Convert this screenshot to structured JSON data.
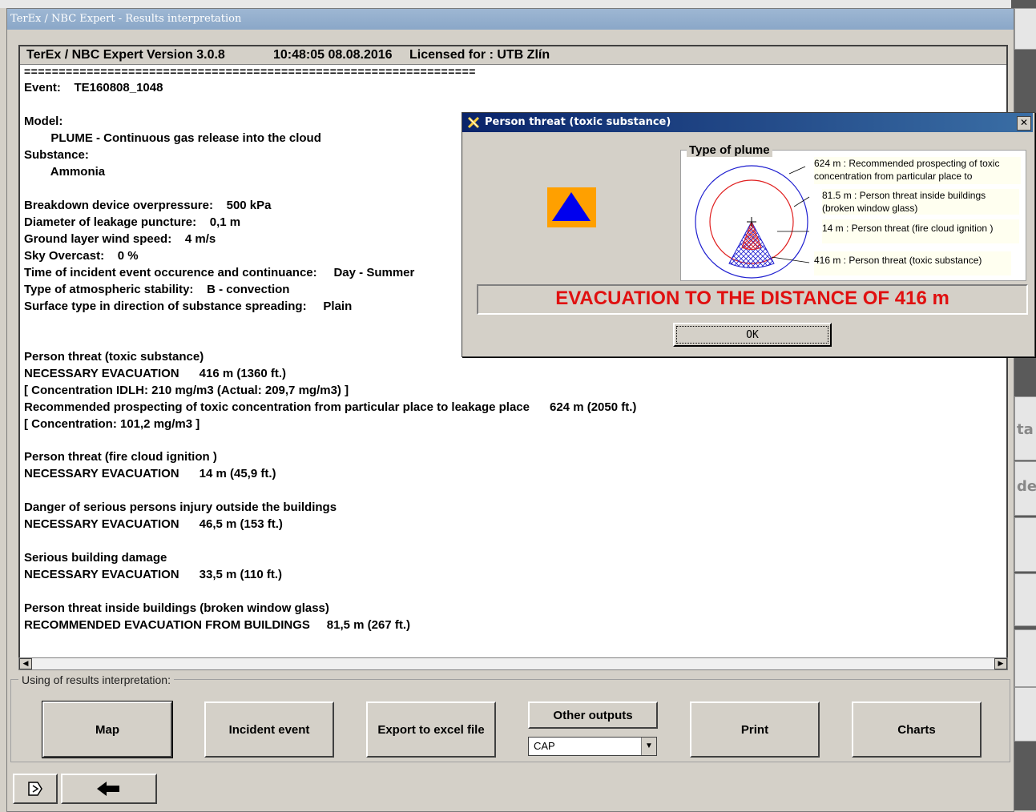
{
  "window": {
    "title": "TerEx / NBC Expert - Results interpretation"
  },
  "report": {
    "header": {
      "app": "TerEx / NBC Expert  Version 3.0.8",
      "datetime": "10:48:05  08.08.2016",
      "license": "Licensed for : UTB Zlín"
    },
    "separator": "=================================================================",
    "lines": [
      "Event:    TE160808_1048",
      "Model:",
      "        PLUME - Continuous gas release into the cloud",
      "Substance:",
      "        Ammonia",
      "Breakdown device overpressure:    500 kPa",
      "Diameter of leakage puncture:    0,1 m",
      "Ground layer wind speed:    4 m/s",
      "Sky Overcast:    0 %",
      "Time of incident event occurence and continuance:     Day - Summer",
      "Type of atmospheric stability:    B - convection",
      "Surface type in direction of substance spreading:     Plain",
      "Person threat (toxic substance)",
      "NECESSARY EVACUATION      416 m (1360 ft.)",
      "[ Concentration IDLH: 210 mg/m3 (Actual: 209,7 mg/m3) ]",
      "Recommended prospecting of toxic concentration from particular place to leakage place      624 m (2050 ft.)",
      "[ Concentration: 101,2 mg/m3 ]",
      "Person threat (fire cloud ignition )",
      "NECESSARY EVACUATION      14 m (45,9 ft.)",
      "Danger of serious persons injury outside the buildings",
      "NECESSARY EVACUATION      46,5 m (153 ft.)",
      "Serious building damage",
      "NECESSARY EVACUATION      33,5 m (110 ft.)",
      "Person threat inside buildings (broken window glass)",
      "RECOMMENDED EVACUATION FROM BUILDINGS     81,5 m (267 ft.)"
    ]
  },
  "scrollbar": {
    "left_arrow": "◀",
    "right_arrow": "▶"
  },
  "actions": {
    "group_label": "Using of results interpretation:",
    "map": "Map",
    "incident_event": "Incident event",
    "export_excel": "Export to excel file",
    "other_outputs": "Other outputs",
    "other_outputs_select": "CAP",
    "print": "Print",
    "charts": "Charts"
  },
  "nav": {
    "exit_icon": "exit-icon",
    "back_icon": "back-arrow-icon"
  },
  "right_panel": {
    "text1": "ta",
    "text2": "del"
  },
  "dialog": {
    "title": "Person threat (toxic substance)",
    "close": "✕",
    "plume_legend": "Type of plume",
    "labels": [
      "624 m : Recommended prospecting of toxic concentration from particular place to",
      "81.5 m : Person threat inside buildings (broken window glass)",
      "14 m : Person threat (fire cloud ignition )",
      "416 m : Person threat (toxic substance)"
    ],
    "evacuation": "EVACUATION TO THE DISTANCE OF    416 m",
    "ok": "OK",
    "colors": {
      "hazard_bg": "#ffa000",
      "hazard_triangle": "#0000ee",
      "evac_text": "#e01010",
      "outer_circle": "#2020d0",
      "inner_circle": "#e02020"
    }
  }
}
